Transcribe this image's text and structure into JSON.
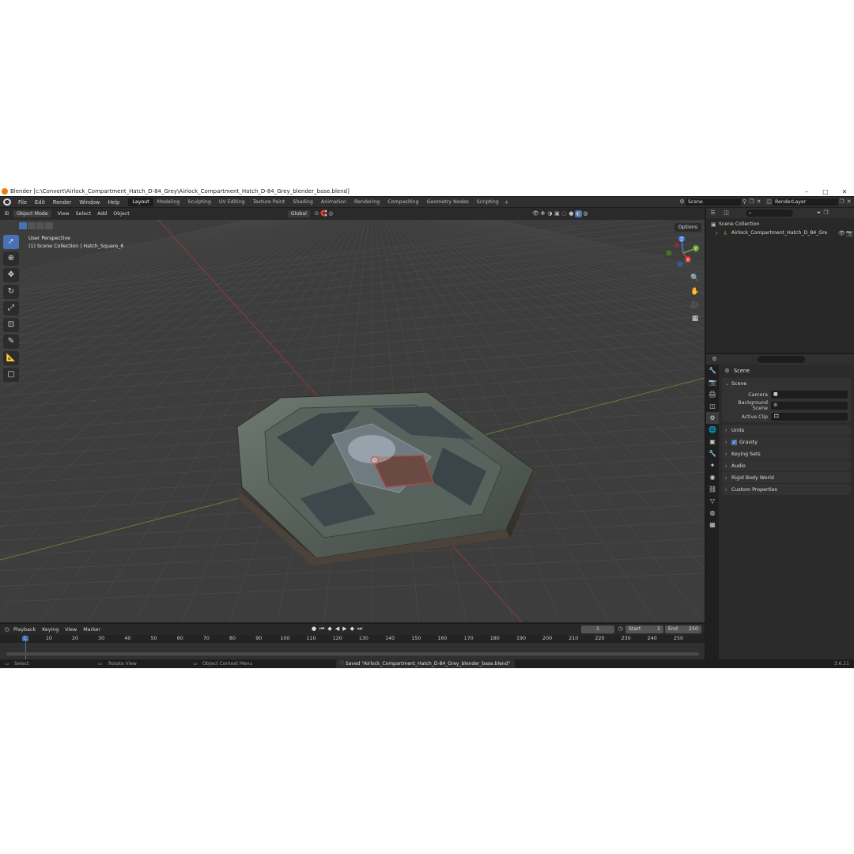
{
  "window": {
    "title": "Blender [c:\\Convert\\Airlock_Compartment_Hatch_D-84_Grey\\Airlock_Compartment_Hatch_D-84_Grey_blender_base.blend]",
    "minimize": "–",
    "maximize": "□",
    "close": "✕"
  },
  "menu": {
    "items": [
      "File",
      "Edit",
      "Render",
      "Window",
      "Help"
    ],
    "workspaces": [
      "Layout",
      "Modeling",
      "Sculpting",
      "UV Editing",
      "Texture Paint",
      "Shading",
      "Animation",
      "Rendering",
      "Compositing",
      "Geometry Nodes",
      "Scripting"
    ],
    "active_workspace": "Layout",
    "add": "+",
    "scene": "Scene",
    "view_layer": "RenderLayer"
  },
  "viewport": {
    "mode": "Object Mode",
    "menus": [
      "View",
      "Select",
      "Add",
      "Object"
    ],
    "transform_orientation": "Global",
    "options": "Options",
    "info_line1": "User Perspective",
    "info_line2": "(1) Scene Collection | Hatch_Square_6",
    "gizmo_axes": [
      "Z",
      "Y",
      "X"
    ]
  },
  "timeline": {
    "menus": [
      "Playback",
      "Keying",
      "View",
      "Marker"
    ],
    "current_frame": "1",
    "start_label": "Start",
    "start": "1",
    "end_label": "End",
    "end": "250",
    "ticks": [
      "1",
      "10",
      "20",
      "30",
      "40",
      "50",
      "60",
      "70",
      "80",
      "90",
      "100",
      "110",
      "120",
      "130",
      "140",
      "150",
      "160",
      "170",
      "180",
      "190",
      "200",
      "210",
      "220",
      "230",
      "240",
      "250"
    ]
  },
  "status": {
    "select": "Select",
    "rotate": "Rotate View",
    "context": "Object Context Menu",
    "message": "Saved \"Airlock_Compartment_Hatch_D-84_Grey_blender_base.blend\"",
    "version": "3.6.11"
  },
  "outliner": {
    "root": "Scene Collection",
    "items": [
      "Airlock_Compartment_Hatch_D_84_Gre"
    ]
  },
  "properties": {
    "title": "Scene",
    "scene_panel": "Scene",
    "camera_label": "Camera",
    "background_label": "Background Scene",
    "clip_label": "Active Clip",
    "panels": [
      "Units",
      "Gravity",
      "Keying Sets",
      "Audio",
      "Rigid Body World",
      "Custom Properties"
    ],
    "gravity_checked": true
  },
  "colors": {
    "accent": "#4772b3",
    "x_axis": "#d0353f",
    "y_axis": "#6aa53a",
    "z_axis": "#3c82d6"
  }
}
